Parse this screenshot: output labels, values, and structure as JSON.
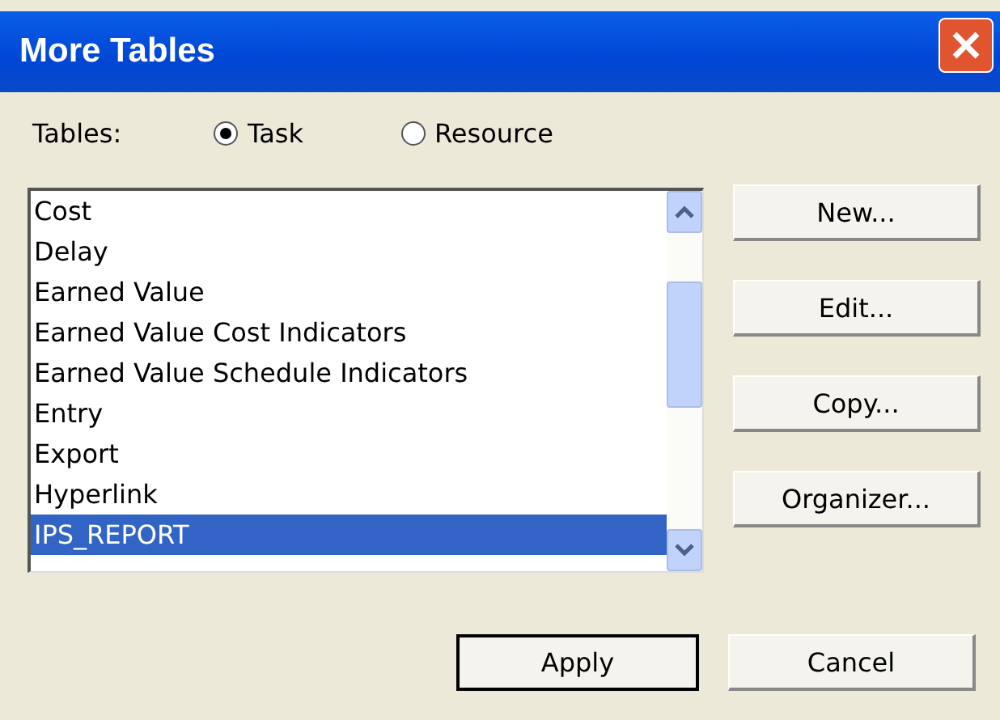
{
  "window": {
    "title": "More Tables"
  },
  "tables_label": "Tables:",
  "options": [
    {
      "label": "Task",
      "selected": true
    },
    {
      "label": "Resource",
      "selected": false
    }
  ],
  "list": {
    "items": [
      {
        "label": "Cost",
        "selected": false
      },
      {
        "label": "Delay",
        "selected": false
      },
      {
        "label": "Earned Value",
        "selected": false
      },
      {
        "label": "Earned Value Cost Indicators",
        "selected": false
      },
      {
        "label": "Earned Value Schedule Indicators",
        "selected": false
      },
      {
        "label": "Entry",
        "selected": false
      },
      {
        "label": "Export",
        "selected": false
      },
      {
        "label": "Hyperlink",
        "selected": false
      },
      {
        "label": "IPS_REPORT",
        "selected": true
      }
    ]
  },
  "side_buttons": [
    "New...",
    "Edit...",
    "Copy...",
    "Organizer..."
  ],
  "bottom_buttons": [
    {
      "label": "Apply",
      "default": true
    },
    {
      "label": "Cancel",
      "default": false
    }
  ]
}
